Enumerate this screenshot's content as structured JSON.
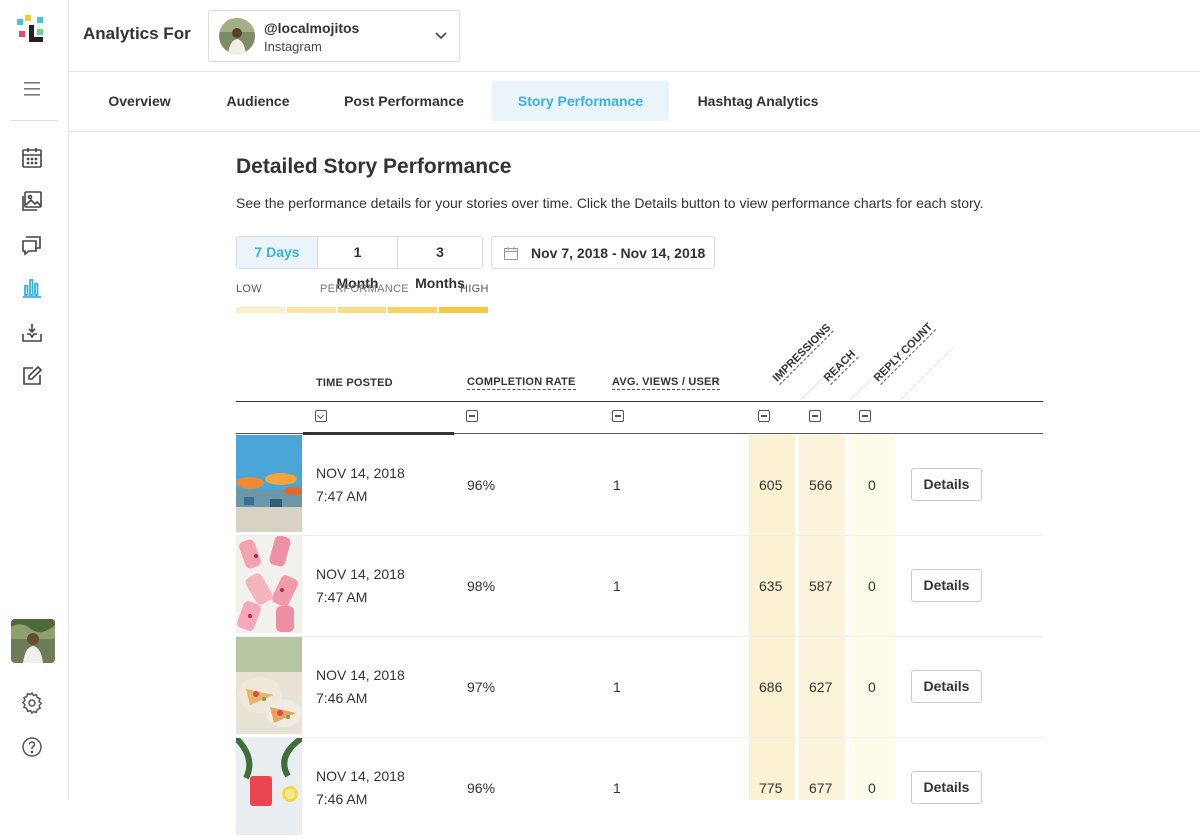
{
  "header": {
    "analytics_for": "Analytics For",
    "account": {
      "name": "@localmojitos",
      "network": "Instagram"
    }
  },
  "tabs": [
    {
      "label": "Overview",
      "active": false
    },
    {
      "label": "Audience",
      "active": false
    },
    {
      "label": "Post Performance",
      "active": false
    },
    {
      "label": "Story Performance",
      "active": true
    },
    {
      "label": "Hashtag Analytics",
      "active": false
    }
  ],
  "page": {
    "title": "Detailed Story Performance",
    "description": "See the performance details for your stories over time. Click the Details button to view performance charts for each story."
  },
  "range": {
    "options": [
      "7 Days",
      "1 Month",
      "3 Months"
    ],
    "selected": "7 Days",
    "date_range": "Nov 7, 2018 - Nov 14, 2018"
  },
  "legend": {
    "low": "LOW",
    "mid": "PERFORMANCE",
    "high": "HIGH"
  },
  "table": {
    "columns": {
      "time_posted": "TIME POSTED",
      "completion_rate": "COMPLETION RATE",
      "avg_views": "AVG. VIEWS / USER",
      "impressions": "IMPRESSIONS",
      "reach": "REACH",
      "reply_count": "REPLY COUNT"
    },
    "details_label": "Details",
    "rows": [
      {
        "date": "NOV 14, 2018",
        "time": "7:47 AM",
        "completion": "96%",
        "avg_views": "1",
        "impressions": "605",
        "reach": "566",
        "replies": "0"
      },
      {
        "date": "NOV 14, 2018",
        "time": "7:47 AM",
        "completion": "98%",
        "avg_views": "1",
        "impressions": "635",
        "reach": "587",
        "replies": "0"
      },
      {
        "date": "NOV 14, 2018",
        "time": "7:46 AM",
        "completion": "97%",
        "avg_views": "1",
        "impressions": "686",
        "reach": "627",
        "replies": "0"
      },
      {
        "date": "NOV 14, 2018",
        "time": "7:46 AM",
        "completion": "96%",
        "avg_views": "1",
        "impressions": "775",
        "reach": "677",
        "replies": "0"
      }
    ]
  },
  "colors": {
    "accent": "#3ab0e2",
    "active_bg": "#eaf4fa",
    "heat_low": "#fdfbe8",
    "heat_mid": "#fbf3d6",
    "legend_gradient": [
      "#fbeec4",
      "#f9e6a6",
      "#f8dd87",
      "#f6d363",
      "#f4c93c"
    ]
  },
  "sidebar_icons": [
    "logo-icon",
    "menu-icon",
    "calendar-icon",
    "image-icon",
    "chat-icon",
    "bar-chart-icon",
    "download-icon",
    "edit-icon",
    "settings-icon",
    "help-icon"
  ]
}
